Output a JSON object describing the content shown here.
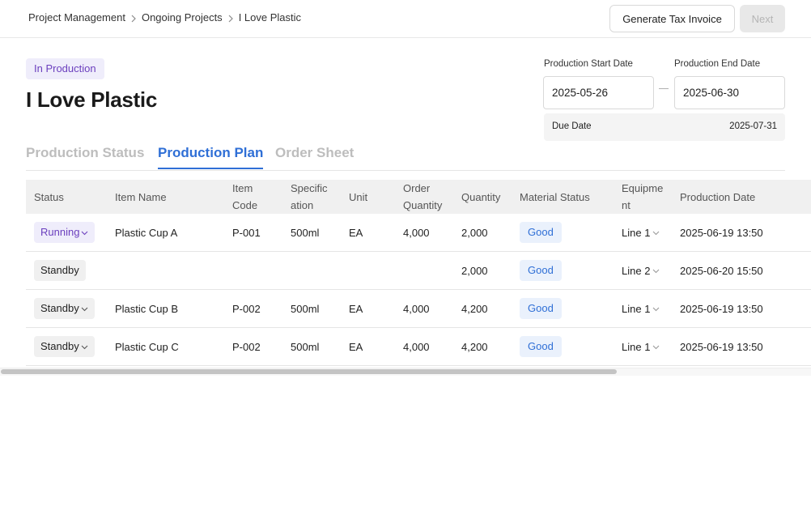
{
  "breadcrumb": {
    "items": [
      "Project Management",
      "Ongoing Projects",
      "I Love Plastic"
    ]
  },
  "toolbar": {
    "tax_invoice_label": "Generate Tax Invoice",
    "next_label": "Next"
  },
  "project": {
    "status_badge": "In Production",
    "title": "I Love Plastic"
  },
  "dates": {
    "start_label": "Production Start Date",
    "start_value": "2025-05-26",
    "end_label": "Production End Date",
    "end_value": "2025-06-30",
    "due_label": "Due Date",
    "due_value": "2025-07-31"
  },
  "tabs": [
    {
      "label": "Production Status",
      "active": false
    },
    {
      "label": "Production Plan",
      "active": true
    },
    {
      "label": "Order Sheet",
      "active": false
    }
  ],
  "table": {
    "headers": {
      "status": "Status",
      "item_name": "Item Name",
      "item_code": "Item Code",
      "specification": "Specification",
      "unit": "Unit",
      "order_quantity": "Order Quantity",
      "quantity": "Quantity",
      "material_status": "Material Status",
      "equipment": "Equipment",
      "production_date": "Production Date"
    },
    "rows": [
      {
        "status": "Running",
        "status_dropdown": true,
        "item_name": "Plastic Cup A",
        "item_code": "P-001",
        "specification": "500ml",
        "unit": "EA",
        "order_quantity": "4,000",
        "quantity": "2,000",
        "material_status": "Good",
        "equipment": "Line 1",
        "production_date": "2025-06-19 13:50"
      },
      {
        "status": "Standby",
        "status_dropdown": false,
        "item_name": "",
        "item_code": "",
        "specification": "",
        "unit": "",
        "order_quantity": "",
        "quantity": "2,000",
        "material_status": "Good",
        "equipment": "Line 2",
        "production_date": "2025-06-20 15:50"
      },
      {
        "status": "Standby",
        "status_dropdown": true,
        "item_name": "Plastic Cup B",
        "item_code": "P-002",
        "specification": "500ml",
        "unit": "EA",
        "order_quantity": "4,000",
        "quantity": "4,200",
        "material_status": "Good",
        "equipment": "Line 1",
        "production_date": "2025-06-19 13:50"
      },
      {
        "status": "Standby",
        "status_dropdown": true,
        "item_name": "Plastic Cup C",
        "item_code": "P-002",
        "specification": "500ml",
        "unit": "EA",
        "order_quantity": "4,000",
        "quantity": "4,200",
        "material_status": "Good",
        "equipment": "Line 1",
        "production_date": "2025-06-19 13:50"
      }
    ]
  },
  "colors": {
    "accent": "#2f6fd6",
    "status_running": "#6b3fbe",
    "material_good": "#2f6fd6"
  }
}
